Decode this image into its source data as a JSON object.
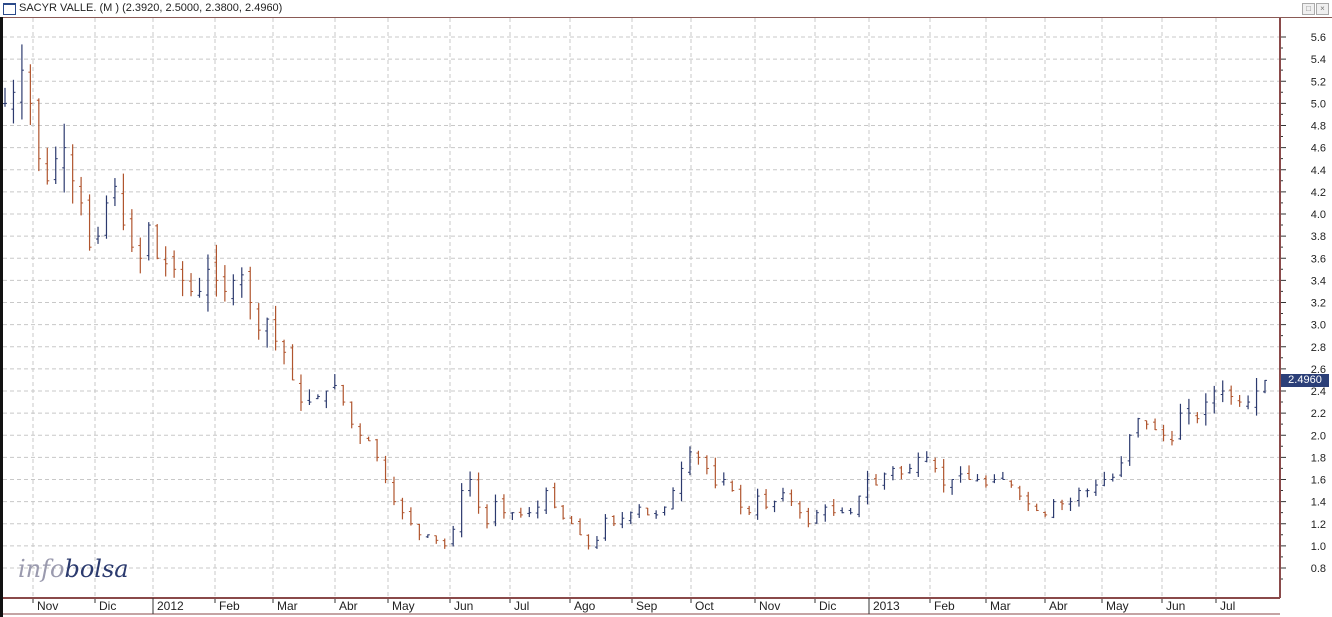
{
  "window": {
    "title": "SACYR VALLE. (M ) (2.3920, 2.5000, 2.3800, 2.4960)",
    "restore_icon": "restore-icon",
    "close_icon": "close-icon"
  },
  "watermark": {
    "part1": "info",
    "part2": "bolsa"
  },
  "chart_data": {
    "type": "ohlc-bar",
    "title": "SACYR VALLE. (M )",
    "last_ohlc": {
      "open": 2.392,
      "high": 2.5,
      "low": 2.38,
      "close": 2.496
    },
    "last_price_label": "2.4960",
    "ylim": [
      0.6,
      5.8
    ],
    "y_ticks": [
      "5.6",
      "5.4",
      "5.2",
      "5.0",
      "4.8",
      "4.6",
      "4.4",
      "4.2",
      "4.0",
      "3.8",
      "3.6",
      "3.4",
      "3.2",
      "3.0",
      "2.8",
      "2.6",
      "2.4",
      "2.2",
      "2.0",
      "1.8",
      "1.6",
      "1.4",
      "1.2",
      "1.0",
      "0.8"
    ],
    "x_ticks": [
      "Nov",
      "Dic",
      "2012",
      "Feb",
      "Mar",
      "Abr",
      "May",
      "Jun",
      "Jul",
      "Ago",
      "Sep",
      "Oct",
      "Nov",
      "Dic",
      "2013",
      "Feb",
      "Mar",
      "Abr",
      "May",
      "Jun",
      "Jul"
    ],
    "grid": true,
    "colors": {
      "up": "#2c3a6e",
      "down": "#b0552e",
      "grid": "#c8c8c8",
      "axis": "#8a4a4a"
    },
    "closes": [
      5.0,
      5.1,
      5.3,
      5.0,
      4.5,
      4.3,
      4.5,
      4.6,
      4.3,
      4.1,
      3.7,
      3.8,
      4.1,
      4.25,
      3.9,
      3.7,
      3.6,
      3.9,
      3.6,
      3.55,
      3.5,
      3.4,
      3.3,
      3.3,
      3.5,
      3.4,
      3.3,
      3.4,
      3.45,
      3.2,
      2.95,
      3.05,
      2.85,
      2.75,
      2.5,
      2.3,
      2.3,
      2.35,
      2.4,
      2.45,
      2.3,
      2.1,
      2.0,
      1.95,
      1.8,
      1.6,
      1.4,
      1.3,
      1.2,
      1.1,
      1.1,
      1.05,
      1.0,
      1.15,
      1.5,
      1.6,
      1.35,
      1.2,
      1.4,
      1.3,
      1.3,
      1.28,
      1.3,
      1.35,
      1.5,
      1.35,
      1.25,
      1.2,
      1.1,
      1.0,
      1.05,
      1.25,
      1.2,
      1.25,
      1.3,
      1.35,
      1.28,
      1.28,
      1.35,
      1.5,
      1.7,
      1.85,
      1.8,
      1.7,
      1.55,
      1.6,
      1.5,
      1.35,
      1.3,
      1.45,
      1.35,
      1.4,
      1.48,
      1.4,
      1.3,
      1.2,
      1.3,
      1.35,
      1.3,
      1.3,
      1.3,
      1.45,
      1.6,
      1.55,
      1.65,
      1.7,
      1.65,
      1.7,
      1.8,
      1.8,
      1.7,
      1.55,
      1.6,
      1.65,
      1.6,
      1.6,
      1.55,
      1.6,
      1.6,
      1.55,
      1.45,
      1.38,
      1.32,
      1.28,
      1.4,
      1.38,
      1.4,
      1.5,
      1.5,
      1.55,
      1.6,
      1.62,
      1.75,
      2.0,
      2.15,
      2.1,
      2.05,
      2.0,
      1.95,
      2.2,
      2.2,
      2.15,
      2.3,
      2.4,
      2.4,
      2.35,
      2.3,
      2.3,
      2.4,
      2.496
    ]
  }
}
